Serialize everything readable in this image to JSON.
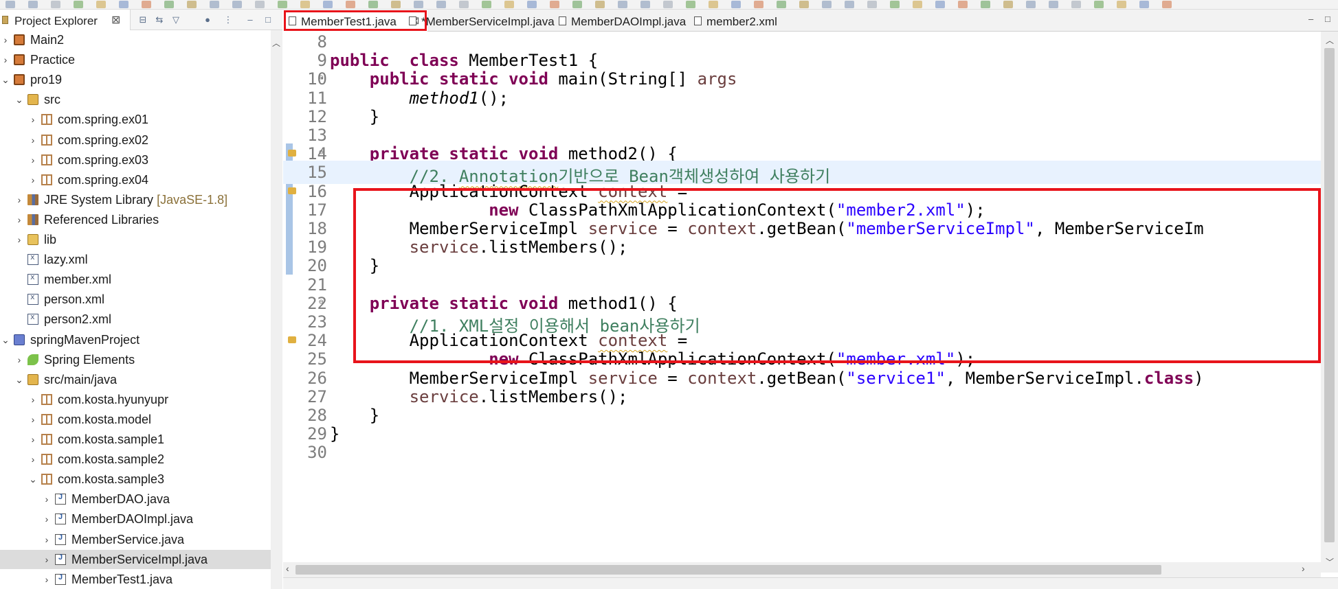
{
  "project_explorer": {
    "tab_label": "Project Explorer",
    "close_glyph": "⊠"
  },
  "tree": [
    {
      "label": "Main2",
      "indent": 0,
      "twisty": "›",
      "icon": "project-icon"
    },
    {
      "label": "Practice",
      "indent": 0,
      "twisty": "›",
      "icon": "project-icon"
    },
    {
      "label": "pro19",
      "indent": 0,
      "twisty": "⌄",
      "icon": "project-icon"
    },
    {
      "label": "src",
      "indent": 1,
      "twisty": "⌄",
      "icon": "source-folder-icon"
    },
    {
      "label": "com.spring.ex01",
      "indent": 2,
      "twisty": "›",
      "icon": "package-icon"
    },
    {
      "label": "com.spring.ex02",
      "indent": 2,
      "twisty": "›",
      "icon": "package-icon"
    },
    {
      "label": "com.spring.ex03",
      "indent": 2,
      "twisty": "›",
      "icon": "package-icon"
    },
    {
      "label": "com.spring.ex04",
      "indent": 2,
      "twisty": "›",
      "icon": "package-icon"
    },
    {
      "label": "JRE System Library",
      "decoration": "[JavaSE-1.8]",
      "indent": 1,
      "twisty": "›",
      "icon": "library-icon"
    },
    {
      "label": "Referenced Libraries",
      "indent": 1,
      "twisty": "›",
      "icon": "library-icon"
    },
    {
      "label": "lib",
      "indent": 1,
      "twisty": "›",
      "icon": "folder-icon"
    },
    {
      "label": "lazy.xml",
      "indent": 1,
      "twisty": "",
      "icon": "xml-file-icon"
    },
    {
      "label": "member.xml",
      "indent": 1,
      "twisty": "",
      "icon": "xml-file-icon"
    },
    {
      "label": "person.xml",
      "indent": 1,
      "twisty": "",
      "icon": "xml-file-icon"
    },
    {
      "label": "person2.xml",
      "indent": 1,
      "twisty": "",
      "icon": "xml-file-icon"
    },
    {
      "label": "springMavenProject",
      "indent": 0,
      "twisty": "⌄",
      "icon": "maven-project-icon"
    },
    {
      "label": "Spring Elements",
      "indent": 1,
      "twisty": "›",
      "icon": "spring-icon"
    },
    {
      "label": "src/main/java",
      "indent": 1,
      "twisty": "⌄",
      "icon": "source-folder-icon"
    },
    {
      "label": "com.kosta.hyunyupr",
      "indent": 2,
      "twisty": "›",
      "icon": "package-icon"
    },
    {
      "label": "com.kosta.model",
      "indent": 2,
      "twisty": "›",
      "icon": "package-icon"
    },
    {
      "label": "com.kosta.sample1",
      "indent": 2,
      "twisty": "›",
      "icon": "package-icon"
    },
    {
      "label": "com.kosta.sample2",
      "indent": 2,
      "twisty": "›",
      "icon": "package-icon"
    },
    {
      "label": "com.kosta.sample3",
      "indent": 2,
      "twisty": "⌄",
      "icon": "package-icon"
    },
    {
      "label": "MemberDAO.java",
      "indent": 3,
      "twisty": "›",
      "icon": "java-file-icon"
    },
    {
      "label": "MemberDAOImpl.java",
      "indent": 3,
      "twisty": "›",
      "icon": "java-file-icon"
    },
    {
      "label": "MemberService.java",
      "indent": 3,
      "twisty": "›",
      "icon": "java-file-icon"
    },
    {
      "label": "MemberServiceImpl.java",
      "indent": 3,
      "twisty": "›",
      "icon": "java-file-icon",
      "selected": true
    },
    {
      "label": "MemberTest1.java",
      "indent": 3,
      "twisty": "›",
      "icon": "java-file-icon"
    }
  ],
  "editor": {
    "tabs": [
      {
        "label": "MemberTest1.java",
        "active": true,
        "close": "⊠"
      },
      {
        "label": "*MemberServiceImpl.java",
        "active": false
      },
      {
        "label": "MemberDAOImpl.java",
        "active": false
      },
      {
        "label": "member2.xml",
        "active": false
      }
    ],
    "current_line": "15",
    "lines": [
      {
        "n": "8",
        "tokens": []
      },
      {
        "n": "9",
        "tokens": [
          [
            "kw",
            "public"
          ],
          [
            "",
            "  "
          ],
          [
            "kw",
            "class"
          ],
          [
            "",
            " MemberTest1 {"
          ]
        ]
      },
      {
        "n": "10",
        "fold": "⊖",
        "tokens": [
          [
            "",
            "    "
          ],
          [
            "kw",
            "public"
          ],
          [
            "",
            " "
          ],
          [
            "kw",
            "static"
          ],
          [
            "",
            " "
          ],
          [
            "kw",
            "void"
          ],
          [
            "",
            " main(String[] "
          ],
          [
            "var",
            "args"
          ],
          [
            ") {"
          ]
        ]
      },
      {
        "n": "11",
        "tokens": [
          [
            "",
            "        "
          ],
          [
            "it",
            "method1"
          ],
          [
            "",
            "();"
          ]
        ]
      },
      {
        "n": "12",
        "tokens": [
          [
            "",
            "    }"
          ]
        ]
      },
      {
        "n": "13",
        "tokens": []
      },
      {
        "n": "14",
        "fold": "⊖",
        "marker": true,
        "tokens": [
          [
            "",
            "    "
          ],
          [
            "kw",
            "private"
          ],
          [
            "",
            " "
          ],
          [
            "kw",
            "static"
          ],
          [
            "",
            " "
          ],
          [
            "kw",
            "void"
          ],
          [
            "",
            " "
          ],
          [
            "uline",
            "method2"
          ],
          [
            "",
            "() {"
          ]
        ]
      },
      {
        "n": "15",
        "tokens": [
          [
            "",
            "        "
          ],
          [
            "cm",
            "//2. "
          ],
          [
            "cm-u",
            "Annotation"
          ],
          [
            "cm",
            "기반으로 Bean객체생성하여 사용하기"
          ]
        ]
      },
      {
        "n": "16",
        "marker": true,
        "tokens": [
          [
            "",
            "        ApplicationContext "
          ],
          [
            "var-u",
            "context"
          ],
          [
            "",
            " ="
          ]
        ]
      },
      {
        "n": "17",
        "tokens": [
          [
            "",
            "                "
          ],
          [
            "kw",
            "new"
          ],
          [
            "",
            " ClassPathXmlApplicationContext("
          ],
          [
            "st",
            "\"member2.xml\""
          ],
          [
            "",
            ");"
          ]
        ]
      },
      {
        "n": "18",
        "tokens": [
          [
            "",
            "        MemberServiceImpl "
          ],
          [
            "var",
            "service"
          ],
          [
            "",
            " = "
          ],
          [
            "var",
            "context"
          ],
          [
            "",
            ".getBean("
          ],
          [
            "st",
            "\"memberServiceImpl\""
          ],
          [
            "",
            ", MemberServiceIm"
          ]
        ]
      },
      {
        "n": "19",
        "tokens": [
          [
            "",
            "        "
          ],
          [
            "var",
            "service"
          ],
          [
            "",
            ".listMembers();"
          ]
        ]
      },
      {
        "n": "20",
        "tokens": [
          [
            "",
            "    }"
          ]
        ]
      },
      {
        "n": "21",
        "tokens": []
      },
      {
        "n": "22",
        "fold": "⊖",
        "tokens": [
          [
            "",
            "    "
          ],
          [
            "kw",
            "private"
          ],
          [
            "",
            " "
          ],
          [
            "kw",
            "static"
          ],
          [
            "",
            " "
          ],
          [
            "kw",
            "void"
          ],
          [
            "",
            " method1() {"
          ]
        ]
      },
      {
        "n": "23",
        "tokens": [
          [
            "",
            "        "
          ],
          [
            "cm",
            "//1. XML설정 이용해서 bean사용하기"
          ]
        ]
      },
      {
        "n": "24",
        "marker": true,
        "tokens": [
          [
            "",
            "        ApplicationContext "
          ],
          [
            "var-u",
            "context"
          ],
          [
            "",
            " ="
          ]
        ]
      },
      {
        "n": "25",
        "tokens": [
          [
            "",
            "                "
          ],
          [
            "kw",
            "new"
          ],
          [
            "",
            " ClassPathXmlApplicationContext("
          ],
          [
            "st",
            "\"member.xml\""
          ],
          [
            "",
            ");"
          ]
        ]
      },
      {
        "n": "26",
        "tokens": [
          [
            "",
            "        MemberServiceImpl "
          ],
          [
            "var",
            "service"
          ],
          [
            "",
            " = "
          ],
          [
            "var",
            "context"
          ],
          [
            "",
            ".getBean("
          ],
          [
            "st",
            "\"service1\""
          ],
          [
            "",
            ", MemberServiceImpl."
          ],
          [
            "kw",
            "class"
          ],
          [
            "",
            ")"
          ]
        ]
      },
      {
        "n": "27",
        "tokens": [
          [
            "",
            "        "
          ],
          [
            "var",
            "service"
          ],
          [
            "",
            ".listMembers();"
          ]
        ]
      },
      {
        "n": "28",
        "tokens": [
          [
            "",
            "    }"
          ]
        ]
      },
      {
        "n": "29",
        "tokens": [
          [
            "",
            "}"
          ]
        ]
      },
      {
        "n": "30",
        "tokens": []
      }
    ]
  },
  "colors": {
    "keyword": "#7f0055",
    "comment": "#3f7f5f",
    "string": "#2a00ff",
    "variable": "#6a3e3e",
    "highlight_box": "#e8141b",
    "current_line": "#e8f2fe"
  }
}
